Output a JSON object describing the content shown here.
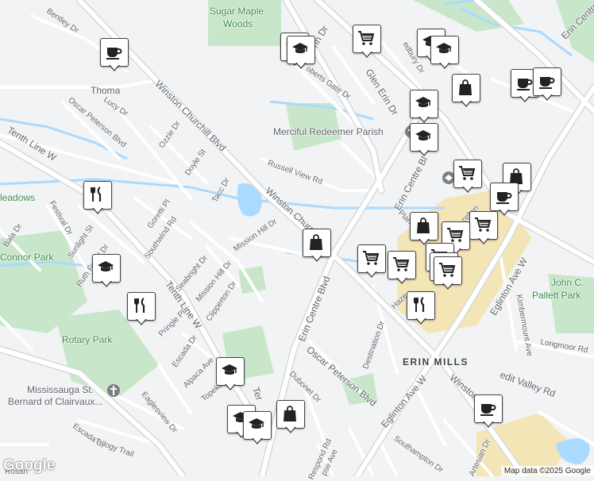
{
  "map": {
    "colors": {
      "background": "#f1f3f4",
      "park": "#c8e6c9",
      "water": "#aadaff",
      "commercial": "#f3e5b5",
      "road": "#ffffff",
      "road_edge": "#d6d9dc"
    },
    "attribution": "Map data ©2025 Google",
    "logo": "Google"
  },
  "labels": {
    "sugar_maple": "Sugar Maple",
    "woods": "Woods",
    "merciful": "Merciful Redeemer Parish",
    "rotary_park": "Rotary Park",
    "connor_park": "Connor Park",
    "meadows": "leadows",
    "john_c": "John C.",
    "pallett": "Pallett Park",
    "st_bernard_1": "Mississauga St.",
    "st_bernard_2": "Bernard of Clairvaux...",
    "erin_mills": "ERIN MILLS",
    "bentley": "Bentley Dr",
    "thomas": "Thoma",
    "lucy": "Lucy Dr",
    "oscar1": "Oscar Peterson Blvd",
    "ozzie": "Ozzie Dr",
    "tenth1": "Tenth Line W",
    "doyle": "Doyle St",
    "winston1": "Winston Churchill Blvd",
    "tacc": "Tacc Dr",
    "russell": "Russell View Rd",
    "glen_erin": "Glen Erin Dr",
    "erin_dr": "rin Dr",
    "roberts": "oberts Gate Dr",
    "glen_erin2": "Glen Erin Dr",
    "wedley": "edbury Dr",
    "festival": "Festival Dr",
    "goretti": "Goretti Pl",
    "southwind": "Southwind Rd",
    "bala": "Bala Dr",
    "sunlight": "Sunlight St",
    "ruth": "Ruth Fertel Dr",
    "winston2": "Winston Churchi",
    "mission_hill": "Mission Hill Dr",
    "seabright": "Seabright Dr",
    "mission_hill2": "Mission Hill Dr",
    "tenth2": "Tenth Line W",
    "clipperton": "Clipperton Dr",
    "pringle": "Pringle Pl",
    "erin_centre": "Erin Centre Blvd",
    "erin_centre2": "Erin Centre Bl",
    "plantation": "Plantation",
    "hazelton": "Hazelton",
    "hazel2": "Haze",
    "eglinton1": "Eglinton Ave W",
    "kimbermount": "Kimbermount Ave",
    "longmoor": "Longmoor Rd",
    "destination": "Destination Dr",
    "oscar2": "Oscar Peterson Blvd",
    "escada": "Escada Dr",
    "alpaca": "Alpaca Ave",
    "topeka": "Topeka Dr",
    "eaglesview": "Eaglesview Dr",
    "escada2": "Escada Dr",
    "trilogy": "Trilogy Trail",
    "dubonet": "Dubonet Dr",
    "eglinton2": "Eglinton Ave W",
    "winston3": "Winston Chu",
    "credit": "edit Valley Rd",
    "southampton": "Southampton Dr",
    "respond": "Respond Rd",
    "artesian": "Artesian Dr",
    "erin_ctr_top": "Erin Centre",
    "rosan": "Rosan",
    "pse": "pse Ave",
    "terr": "Ter"
  },
  "pins": [
    {
      "icon": "coffee"
    },
    {
      "icon": "education"
    },
    {
      "icon": "education"
    },
    {
      "icon": "shopping-cart"
    },
    {
      "icon": "education"
    },
    {
      "icon": "education"
    },
    {
      "icon": "restaurant"
    },
    {
      "icon": "shopping-bag"
    },
    {
      "icon": "coffee"
    },
    {
      "icon": "coffee"
    },
    {
      "icon": "education"
    },
    {
      "icon": "education"
    },
    {
      "icon": "shopping-cart"
    },
    {
      "icon": "shopping-bag"
    },
    {
      "icon": "coffee"
    },
    {
      "icon": "restaurant"
    },
    {
      "icon": "shopping-bag"
    },
    {
      "icon": "shopping-cart"
    },
    {
      "icon": "shopping-cart"
    },
    {
      "icon": "education"
    },
    {
      "icon": "shopping-bag"
    },
    {
      "icon": "shopping-cart"
    },
    {
      "icon": "shopping-cart"
    },
    {
      "icon": "shopping-cart"
    },
    {
      "icon": "restaurant"
    },
    {
      "icon": "shopping-cart"
    },
    {
      "icon": "restaurant"
    },
    {
      "icon": "education"
    },
    {
      "icon": "education"
    },
    {
      "icon": "education"
    },
    {
      "icon": "shopping-bag"
    },
    {
      "icon": "coffee"
    }
  ]
}
